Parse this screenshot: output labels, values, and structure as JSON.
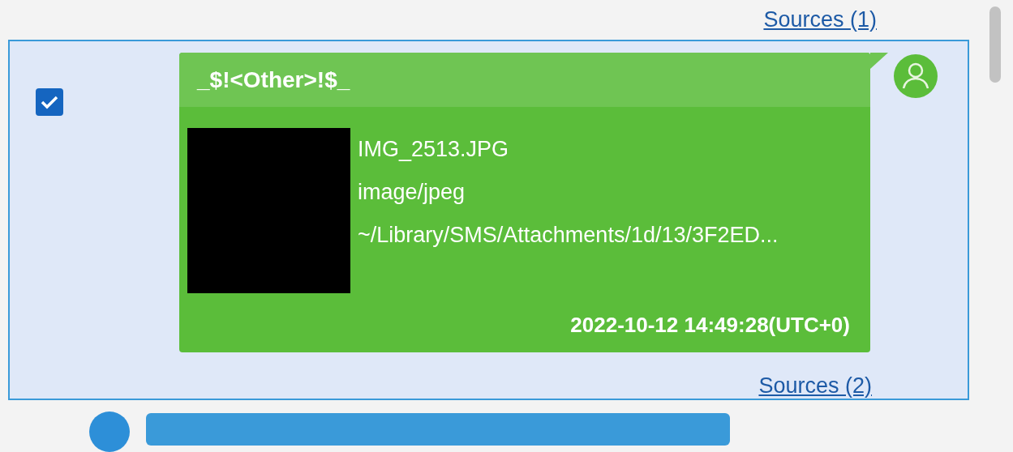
{
  "sources_link_above": "Sources (1)",
  "message": {
    "selected": true,
    "checked": true,
    "sender": "_$!<Other>!$_",
    "attachment": {
      "filename": "IMG_2513.JPG",
      "mime_type": "image/jpeg",
      "path": "~/Library/SMS/Attachments/1d/13/3F2ED..."
    },
    "timestamp": "2022-10-12 14:49:28(UTC+0)",
    "sources_link": "Sources (2)"
  }
}
